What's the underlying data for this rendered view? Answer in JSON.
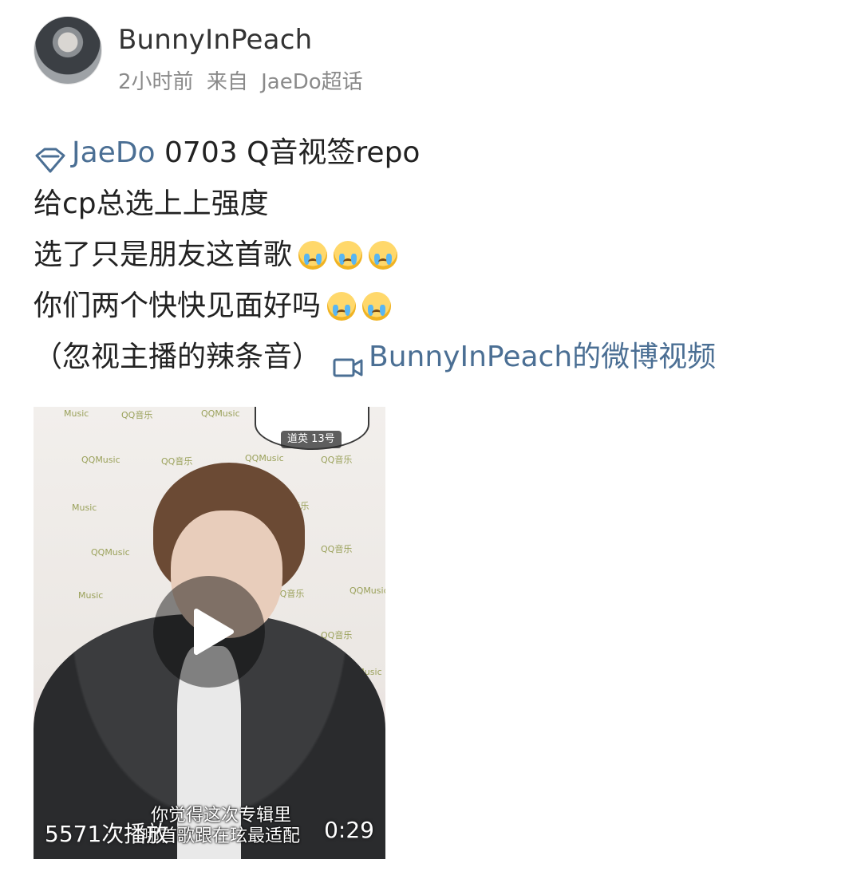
{
  "header": {
    "username": "BunnyInPeach",
    "time": "2小时前",
    "source_prefix": "来自",
    "source": "JaeDo超话"
  },
  "post": {
    "topic_link": "JaeDo",
    "line1_rest": " 0703 Q音视签repo",
    "line2": "给cp总选上上强度",
    "line3": "选了只是朋友这首歌",
    "line3_emojis": [
      "crying-emoji",
      "crying-emoji",
      "crying-emoji"
    ],
    "line4": "你们两个快快见面好吗",
    "line4_emojis": [
      "crying-emoji",
      "crying-emoji"
    ],
    "line5": "（忽视主播的辣条音）",
    "video_link": "BunnyInPeach的微博视频"
  },
  "video": {
    "live_tag": "道英 13号",
    "subtitle_line1": "你觉得这次专辑里",
    "subtitle_line2": "哪首歌跟在玹最适配",
    "views": "5571次播放",
    "duration": "0:29",
    "wall_text": [
      "QQMusic",
      "QQ音乐",
      "Music"
    ]
  },
  "icons": {
    "topic": "diamond-topic-icon",
    "video": "video-camera-icon",
    "play": "play-icon"
  },
  "colors": {
    "link": "#4b6f94",
    "meta": "#8a8a8a",
    "text": "#222222"
  }
}
